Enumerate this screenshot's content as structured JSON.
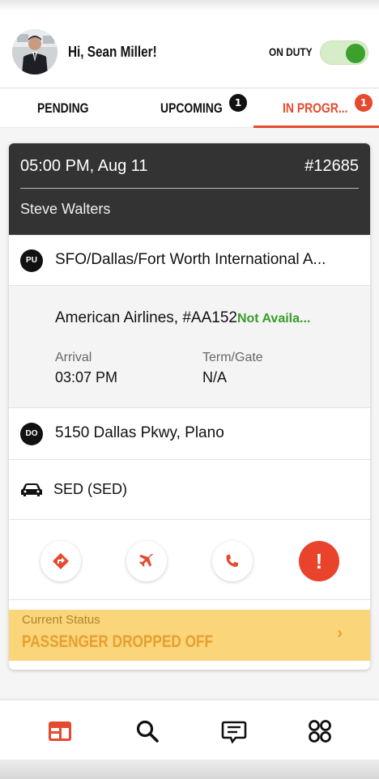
{
  "header": {
    "greeting": "Hi, Sean Miller!",
    "duty_label": "ON DUTY",
    "duty_on": true,
    "toggle_color": "#3ca12c"
  },
  "tabs": [
    {
      "label": "PENDING",
      "badge": null
    },
    {
      "label": "UPCOMING",
      "badge": "1",
      "badge_color": "#111111"
    },
    {
      "label": "IN PROGR...",
      "badge": "1",
      "badge_color": "#e64a2e",
      "active": true
    }
  ],
  "trip": {
    "time": "05:00 PM, Aug 11",
    "number": "#12685",
    "passenger": "Steve Walters",
    "pickup_tag": "PU",
    "pickup": "SFO/Dallas/Fort Worth International A...",
    "flight": {
      "airline": "American Airlines, #AA152",
      "status": "Not Availa...",
      "arrival_label": "Arrival",
      "arrival_value": "03:07 PM",
      "gate_label": "Term/Gate",
      "gate_value": "N/A"
    },
    "dropoff_tag": "DO",
    "dropoff": "5150 Dallas Pkwy, Plano",
    "vehicle_icon": "car-icon",
    "vehicle": "SED (SED)"
  },
  "actions": [
    {
      "icon": "directions-icon"
    },
    {
      "icon": "airplane-icon"
    },
    {
      "icon": "phone-icon"
    },
    {
      "icon": "alert-icon",
      "glyph": "!"
    }
  ],
  "status": {
    "label": "Current Status",
    "value": "PASSENGER DROPPED OFF",
    "chevron": "›",
    "background": "#fad57a"
  },
  "bottom_nav": [
    {
      "icon": "dashboard-icon",
      "active": true
    },
    {
      "icon": "search-icon"
    },
    {
      "icon": "chat-icon"
    },
    {
      "icon": "apps-icon"
    }
  ],
  "colors": {
    "accent": "#e64a2e",
    "success": "#3a9b2a",
    "dark": "#333333"
  }
}
